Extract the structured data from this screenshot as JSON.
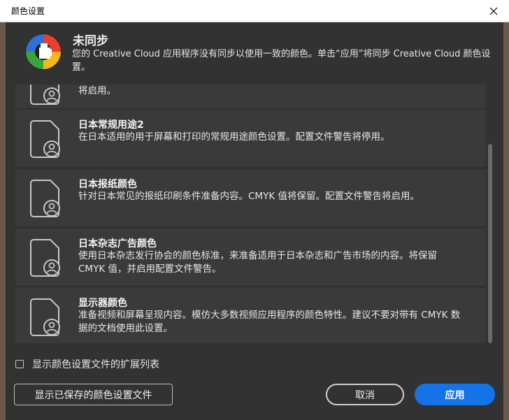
{
  "window": {
    "title": "颜色设置",
    "close_icon": "close-icon"
  },
  "sync": {
    "title": "未同步",
    "description": "您的 Creative Cloud 应用程序没有同步以使用一致的颜色。单击“应用”将同步 Creative Cloud 颜色设置。",
    "logo_icon": "creative-cloud-color-sync-icon"
  },
  "settings_list": [
    {
      "title": "",
      "description": "将启用。",
      "icon": "document-profile-icon"
    },
    {
      "title": "日本常规用途2",
      "description": "在日本适用的用于屏幕和打印的常规用途颜色设置。配置文件警告将停用。",
      "icon": "document-profile-icon"
    },
    {
      "title": "日本报纸颜色",
      "description": "针对日本常见的报纸印刷条件准备内容。CMYK 值将保留。配置文件警告将启用。",
      "icon": "document-profile-icon"
    },
    {
      "title": "日本杂志广告颜色",
      "description": "使用日本杂志发行协会的颜色标准，来准备适用于日本杂志和广告市场的内容。将保留 CMYK 值，并启用配置文件警告。",
      "icon": "document-profile-icon"
    },
    {
      "title": "显示器颜色",
      "description": "准备视频和屏幕呈现内容。模仿大多数视频应用程序的颜色特性。建议不要对带有 CMYK 数据的文档使用此设置。",
      "icon": "document-profile-icon"
    }
  ],
  "expand_list": {
    "label": "显示颜色设置文件的扩展列表",
    "checked": false
  },
  "buttons": {
    "show_saved": "显示已保存的颜色设置文件",
    "cancel": "取消",
    "apply": "应用"
  },
  "colors": {
    "accent": "#1473e6",
    "dialog_bg": "#323232",
    "item_bg": "#3a3a3a"
  }
}
